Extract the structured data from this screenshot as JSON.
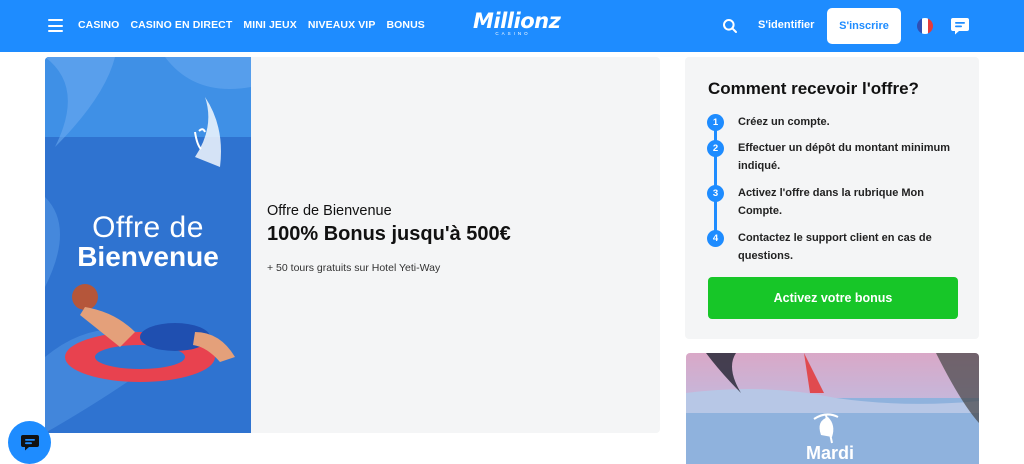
{
  "header": {
    "nav": [
      "CASINO",
      "CASINO EN DIRECT",
      "MINI JEUX",
      "NIVEAUX VIP",
      "BONUS"
    ],
    "logo_text": "Millionz",
    "logo_sub": "CASINO",
    "login_label": "S'identifier",
    "signup_label": "S'inscrire",
    "icons": {
      "menu": "hamburger-icon",
      "search": "search-icon",
      "language": "france-flag-icon",
      "chat": "chat-bubble-icon"
    }
  },
  "promo": {
    "image_line1": "Offre de",
    "image_line2": "Bienvenue",
    "title": "Offre de Bienvenue",
    "bonus": "100% Bonus jusqu'à 500€",
    "free_spins": "+ 50 tours gratuits sur Hotel Yeti-Way"
  },
  "steps_card": {
    "title": "Comment recevoir l'offre?",
    "steps": [
      {
        "num": "1",
        "text": "Créez un compte."
      },
      {
        "num": "2",
        "text": "Effectuer un dépôt du montant minimum indiqué."
      },
      {
        "num": "3",
        "text": "Activez l'offre dans la rubrique Mon Compte."
      },
      {
        "num": "4",
        "text": "Contactez le support client en cas de questions."
      }
    ],
    "cta_label": "Activez votre bonus"
  },
  "second_card": {
    "label": "Mardi"
  },
  "colors": {
    "brand": "#1e8cff",
    "cta": "#17c628",
    "card_bg": "#f4f5f6"
  }
}
